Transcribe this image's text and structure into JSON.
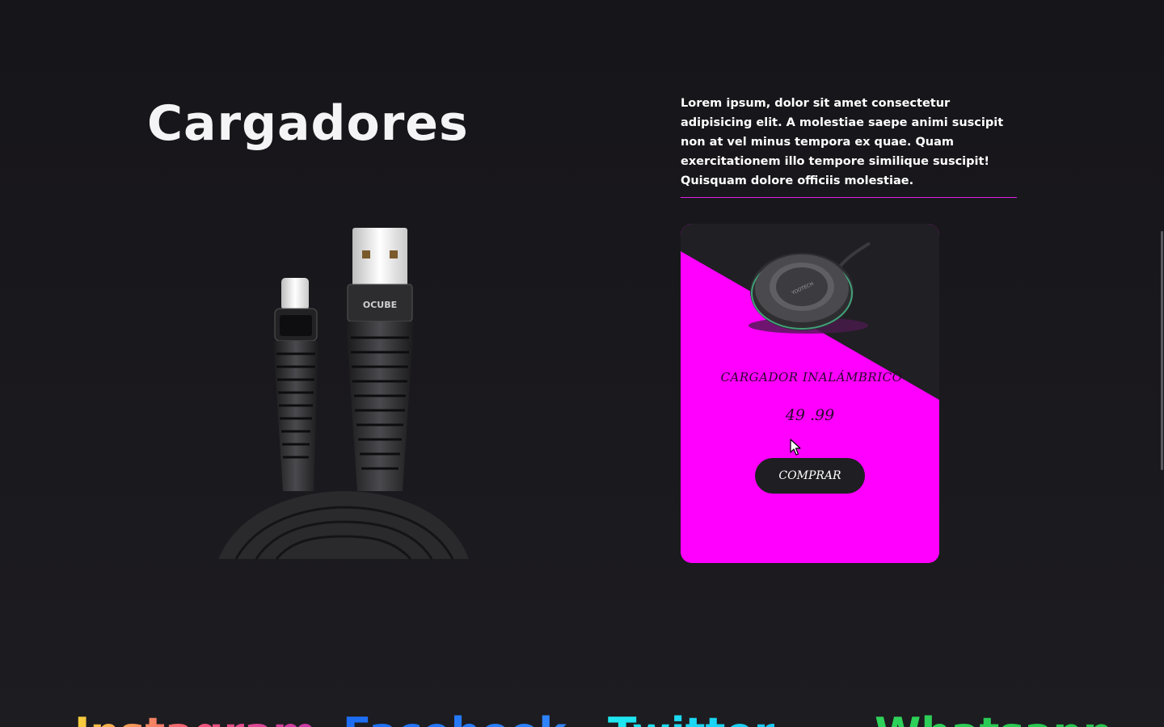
{
  "section": {
    "title": "Cargadores",
    "description": "Lorem ipsum, dolor sit amet consectetur adipisicing elit. A molestiae saepe animi suscipit non at vel minus tempora ex quae. Quam exercitationem illo tempore similique suscipit! Quisquam dolore officiis molestiae."
  },
  "product": {
    "name": "CARGADOR INALÁMBRICO",
    "price": "49 .99",
    "buy_label": "COMPRAR"
  },
  "social": {
    "instagram": "Instagram",
    "facebook": "Facebook",
    "twitter": "Twitter",
    "whatsapp": "Whatsapp"
  },
  "colors": {
    "background": "#1b1a1e",
    "card_accent": "#ff00ff",
    "card_dark": "#1f1e22",
    "divider": "#e01ee6"
  },
  "icons": {
    "cable_image": "usb-cable-image",
    "charger_image": "wireless-charger-image",
    "cursor": "mouse-pointer-icon"
  }
}
